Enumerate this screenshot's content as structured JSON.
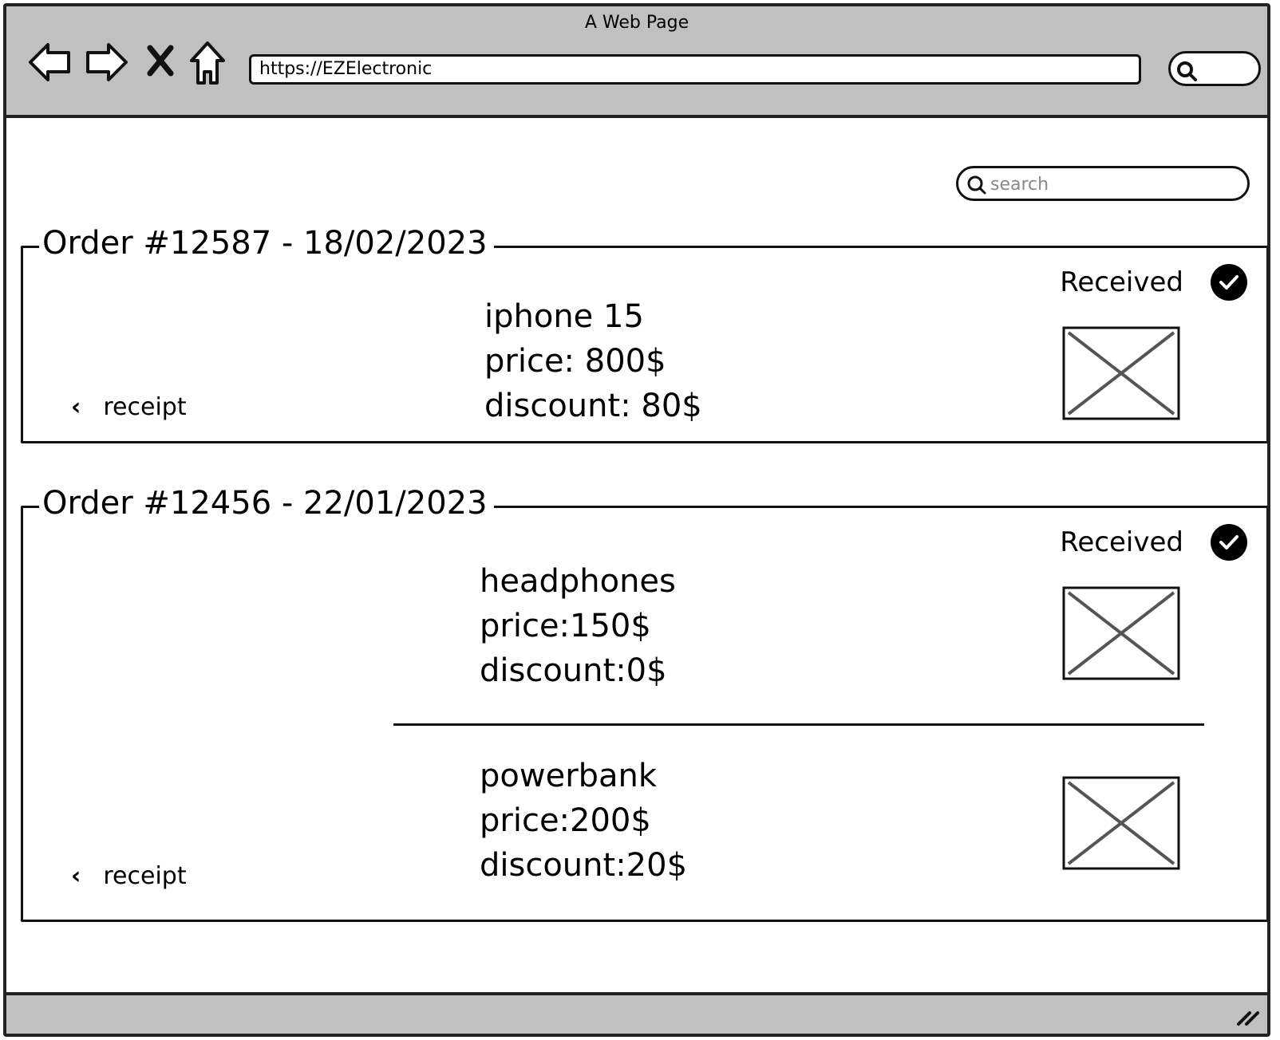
{
  "window": {
    "title": "A Web Page",
    "url": "https://EZElectronic"
  },
  "icons": {
    "back": "back-arrow-icon",
    "forward": "forward-arrow-icon",
    "stop": "close-icon",
    "home": "home-icon",
    "search": "search-icon",
    "status": "check-icon",
    "image": "image-placeholder-icon"
  },
  "search": {
    "placeholder": "search"
  },
  "orders": [
    {
      "title": "Order #12587 - 18/02/2023",
      "status": "Received",
      "receipt_label": "receipt",
      "items": [
        {
          "name": "iphone 15",
          "price": "price: 800$",
          "discount": "discount: 80$"
        }
      ]
    },
    {
      "title": "Order #12456 - 22/01/2023",
      "status": "Received",
      "receipt_label": "receipt",
      "items": [
        {
          "name": "headphones",
          "price": "price:150$",
          "discount": "discount:0$"
        },
        {
          "name": "powerbank",
          "price": "price:200$",
          "discount": "discount:20$"
        }
      ]
    }
  ]
}
